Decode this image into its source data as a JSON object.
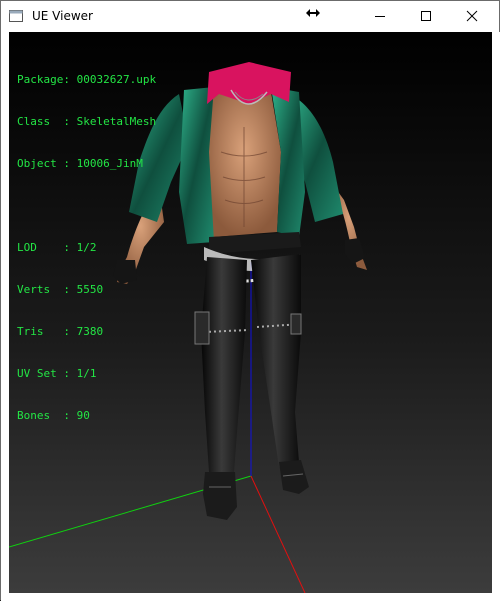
{
  "window": {
    "title": "UE Viewer",
    "buttons": {
      "minimize_icon": "minimize-icon",
      "maximize_icon": "maximize-icon",
      "close_icon": "close-icon"
    }
  },
  "info": {
    "package_label": "Package:",
    "package_value": "00032627.upk",
    "class_label": "Class  :",
    "class_value": "SkeletalMesh",
    "object_label": "Object :",
    "object_value": "10006_JinM",
    "lod_label": "LOD    :",
    "lod_value": "1/2",
    "verts_label": "Verts  :",
    "verts_value": "5550",
    "tris_label": "Tris   :",
    "tris_value": "7380",
    "uvset_label": "UV Set :",
    "uvset_value": "1/1",
    "bones_label": "Bones  :",
    "bones_value": "90"
  },
  "colors": {
    "overlay_text": "#23e645",
    "axis_x": "#e01010",
    "axis_y": "#10d010",
    "axis_z": "#1010e0",
    "jacket": "#1f8a6d",
    "collar": "#d9135f",
    "skin": "#c98a63",
    "pants": "#111111"
  }
}
